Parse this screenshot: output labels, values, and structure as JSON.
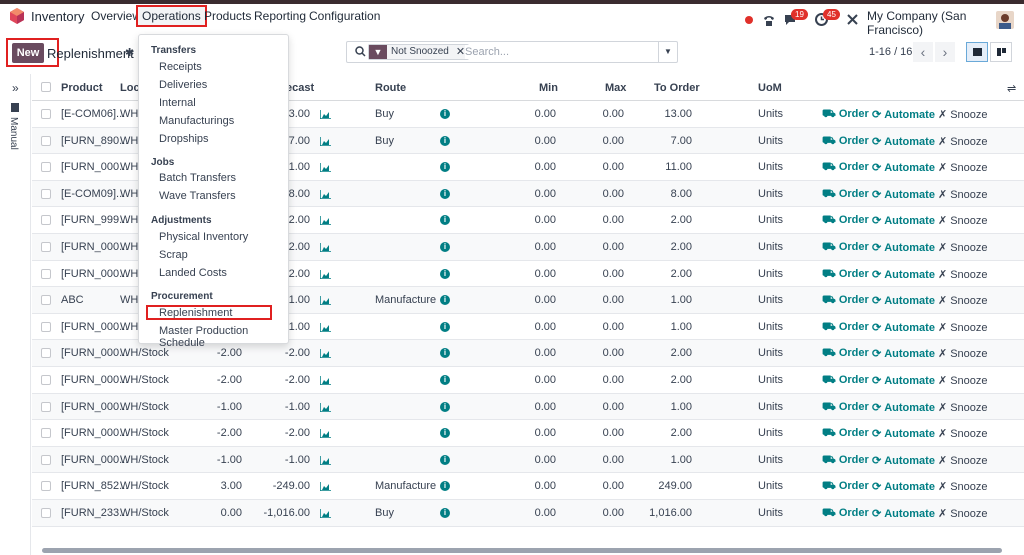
{
  "navbar": {
    "app_name": "Inventory",
    "items": [
      {
        "label": "Overview"
      },
      {
        "label": "Operations"
      },
      {
        "label": "Products"
      },
      {
        "label": "Reporting"
      },
      {
        "label": "Configuration"
      }
    ],
    "chat_count": "19",
    "activity_count": "45",
    "company": "My Company (San Francisco)"
  },
  "control_panel": {
    "new_label": "New",
    "title": "Replenishment",
    "facet_label": "Not Snoozed",
    "search_placeholder": "Search...",
    "pager": "1-16 / 16"
  },
  "side_panel": {
    "label": "Manual"
  },
  "table": {
    "headers": {
      "product": "Product",
      "location": "Loca",
      "forecast": "ecast",
      "route": "Route",
      "min": "Min",
      "max": "Max",
      "to_order": "To Order",
      "uom": "UoM"
    },
    "action_labels": {
      "order": "Order",
      "automate": "Automate",
      "snooze": "Snooze"
    },
    "rows": [
      {
        "product": "[E-COM06]...",
        "location": "WH/",
        "on_hand": "",
        "forecast": "13.00",
        "route": "Buy",
        "min": "0.00",
        "max": "0.00",
        "to_order": "13.00",
        "uom": "Units"
      },
      {
        "product": "[FURN_890...",
        "location": "WH/",
        "on_hand": "",
        "forecast": "-7.00",
        "route": "Buy",
        "min": "0.00",
        "max": "0.00",
        "to_order": "7.00",
        "uom": "Units"
      },
      {
        "product": "[FURN_000...",
        "location": "WH/",
        "on_hand": "",
        "forecast": "11.00",
        "route": "",
        "min": "0.00",
        "max": "0.00",
        "to_order": "11.00",
        "uom": "Units"
      },
      {
        "product": "[E-COM09]...",
        "location": "WH/",
        "on_hand": "",
        "forecast": "-8.00",
        "route": "",
        "min": "0.00",
        "max": "0.00",
        "to_order": "8.00",
        "uom": "Units"
      },
      {
        "product": "[FURN_999...",
        "location": "WH/",
        "on_hand": "",
        "forecast": "-2.00",
        "route": "",
        "min": "0.00",
        "max": "0.00",
        "to_order": "2.00",
        "uom": "Units"
      },
      {
        "product": "[FURN_000...",
        "location": "WH/",
        "on_hand": "",
        "forecast": "-2.00",
        "route": "",
        "min": "0.00",
        "max": "0.00",
        "to_order": "2.00",
        "uom": "Units"
      },
      {
        "product": "[FURN_000...",
        "location": "WH/",
        "on_hand": "",
        "forecast": "-2.00",
        "route": "",
        "min": "0.00",
        "max": "0.00",
        "to_order": "2.00",
        "uom": "Units"
      },
      {
        "product": "ABC",
        "location": "WH/",
        "on_hand": "",
        "forecast": "-1.00",
        "route": "Manufacture",
        "min": "0.00",
        "max": "0.00",
        "to_order": "1.00",
        "uom": "Units"
      },
      {
        "product": "[FURN_000...",
        "location": "WH/",
        "on_hand": "",
        "forecast": "-1.00",
        "route": "",
        "min": "0.00",
        "max": "0.00",
        "to_order": "1.00",
        "uom": "Units"
      },
      {
        "product": "[FURN_000...",
        "location": "WH/Stock",
        "on_hand": "-2.00",
        "forecast": "-2.00",
        "route": "",
        "min": "0.00",
        "max": "0.00",
        "to_order": "2.00",
        "uom": "Units"
      },
      {
        "product": "[FURN_000...",
        "location": "WH/Stock",
        "on_hand": "-2.00",
        "forecast": "-2.00",
        "route": "",
        "min": "0.00",
        "max": "0.00",
        "to_order": "2.00",
        "uom": "Units"
      },
      {
        "product": "[FURN_000...",
        "location": "WH/Stock",
        "on_hand": "-1.00",
        "forecast": "-1.00",
        "route": "",
        "min": "0.00",
        "max": "0.00",
        "to_order": "1.00",
        "uom": "Units"
      },
      {
        "product": "[FURN_000...",
        "location": "WH/Stock",
        "on_hand": "-2.00",
        "forecast": "-2.00",
        "route": "",
        "min": "0.00",
        "max": "0.00",
        "to_order": "2.00",
        "uom": "Units"
      },
      {
        "product": "[FURN_000...",
        "location": "WH/Stock",
        "on_hand": "-1.00",
        "forecast": "-1.00",
        "route": "",
        "min": "0.00",
        "max": "0.00",
        "to_order": "1.00",
        "uom": "Units"
      },
      {
        "product": "[FURN_852...",
        "location": "WH/Stock",
        "on_hand": "3.00",
        "forecast": "-249.00",
        "route": "Manufacture",
        "min": "0.00",
        "max": "0.00",
        "to_order": "249.00",
        "uom": "Units"
      },
      {
        "product": "[FURN_233...",
        "location": "WH/Stock",
        "on_hand": "0.00",
        "forecast": "-1,016.00",
        "route": "Buy",
        "min": "0.00",
        "max": "0.00",
        "to_order": "1,016.00",
        "uom": "Units"
      }
    ]
  },
  "menu": {
    "sections": [
      {
        "title": "Transfers",
        "items": [
          "Receipts",
          "Deliveries",
          "Internal",
          "Manufacturings",
          "Dropships"
        ]
      },
      {
        "title": "Jobs",
        "items": [
          "Batch Transfers",
          "Wave Transfers"
        ]
      },
      {
        "title": "Adjustments",
        "items": [
          "Physical Inventory",
          "Scrap",
          "Landed Costs"
        ]
      },
      {
        "title": "Procurement",
        "items": [
          "Replenishment",
          "Master Production Schedule"
        ]
      }
    ]
  },
  "colors": {
    "brand": "#6a4b5f",
    "accent": "#017e84",
    "highlight": "#e02020"
  }
}
